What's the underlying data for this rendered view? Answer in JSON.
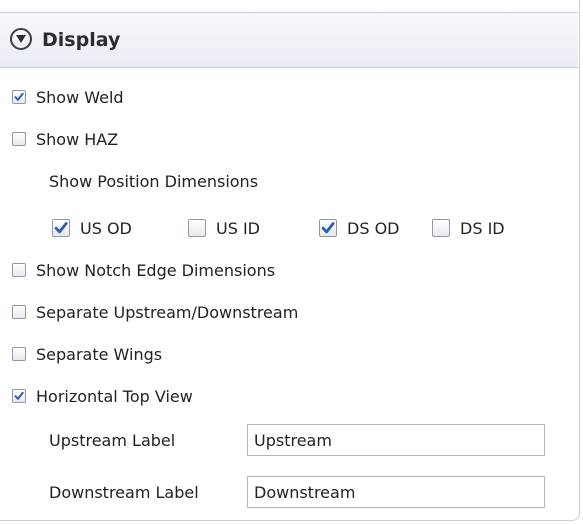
{
  "section": {
    "title": "Display"
  },
  "options": {
    "show_weld": {
      "label": "Show Weld",
      "checked": true
    },
    "show_haz": {
      "label": "Show HAZ",
      "checked": false
    },
    "position_dims_label": "Show Position Dimensions",
    "position_dims": [
      {
        "label": "US OD",
        "checked": true
      },
      {
        "label": "US ID",
        "checked": false
      },
      {
        "label": "DS OD",
        "checked": true
      },
      {
        "label": "DS ID",
        "checked": false
      }
    ],
    "show_notch_edge": {
      "label": "Show Notch Edge Dimensions",
      "checked": false
    },
    "separate_updown": {
      "label": "Separate Upstream/Downstream",
      "checked": false
    },
    "separate_wings": {
      "label": "Separate Wings",
      "checked": false
    },
    "horizontal_top_view": {
      "label": "Horizontal Top View",
      "checked": true
    }
  },
  "fields": {
    "upstream": {
      "label": "Upstream Label",
      "value": "Upstream"
    },
    "downstream": {
      "label": "Downstream Label",
      "value": "Downstream"
    }
  }
}
